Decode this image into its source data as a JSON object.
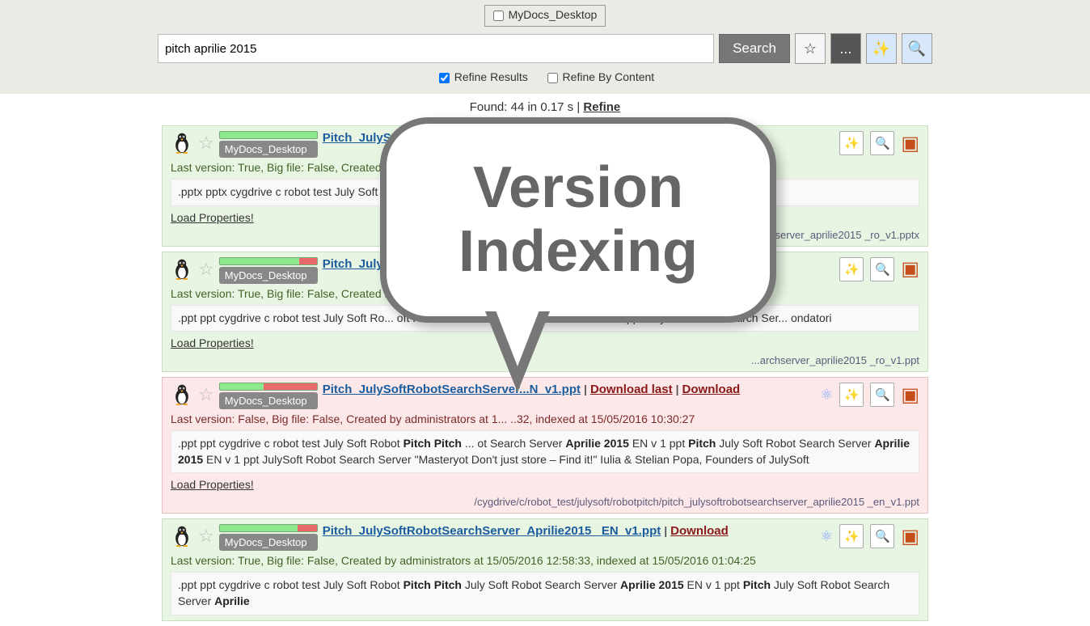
{
  "scope": {
    "label": "MyDocs_Desktop",
    "checked": false
  },
  "search": {
    "query": "pitch aprilie 2015",
    "buttonLabel": "Search",
    "starTitle": "Favorite",
    "moreLabel": "...",
    "wandTitle": "Wizard",
    "previewTitle": "Preview"
  },
  "refine": {
    "refineResults": {
      "label": "Refine Results",
      "checked": true
    },
    "refineByContent": {
      "label": "Refine By Content",
      "checked": false
    }
  },
  "foundBar": {
    "prefix": "Found: ",
    "count": "44",
    "timePrefix": " in ",
    "time": "0.17 s",
    "sep": "  |  ",
    "refineLink": "Refine"
  },
  "callout": {
    "line1": "Version",
    "line2": "Indexing"
  },
  "results": [
    {
      "tone": "green",
      "redPct": 0,
      "badge": "MyDocs_Desktop",
      "title": "Pitch_JulySoft",
      "titleTail": "",
      "downloads": [],
      "meta": "Last version: True, Big file: False, Created by ",
      "snippet": ".pptx pptx cygdrive c robot test July Soft R... y Soft Robot Search Server <b>Aprilie 2015</b> RO v 1 pptx",
      "loadProps": "Load Properties!",
      "path": "...chserver_aprilie2015 _ro_v1.pptx",
      "icons": {
        "ppt": true,
        "wand": true,
        "preview": true,
        "graph": false
      }
    },
    {
      "tone": "green",
      "redPct": 18,
      "badge": "MyDocs_Desktop",
      "title": "Pitch_July",
      "titleTail": "",
      "downloads": [],
      "meta": "Last version: True, Big file: False, Created by ",
      "snippet": ".ppt ppt cygdrive c robot test July Soft Ro... oft Robot Search Server <b>Aprilie 2015</b> RO v 1 ppt JulySoft Robot Search Ser... ondatori",
      "loadProps": "Load Properties!",
      "path": "...archserver_aprilie2015 _ro_v1.ppt",
      "icons": {
        "ppt": true,
        "wand": true,
        "preview": true,
        "graph": false
      }
    },
    {
      "tone": "pink",
      "redPct": 55,
      "badge": "MyDocs_Desktop",
      "title": "Pitch_JulySoftRobotSearchServer",
      "titleTail": "...N_v1.ppt",
      "downloads": [
        "Download last",
        "Download"
      ],
      "meta": "Last version: False, Big file: False, Created by administrators at 1... ..32, indexed at 15/05/2016 10:30:27",
      "snippet": ".ppt ppt cygdrive c robot test July Soft Robot <b>Pitch Pitch</b> ... ot Search Server <b>Aprilie 2015</b> EN v 1 ppt <b>Pitch</b> July Soft Robot Search Server <b>Aprilie 2015</b> EN v 1 ppt JulySoft Robot Search Server \"Masteryot     Don't just store – Find it!\" Iulia & Stelian Popa, Founders of JulySoft",
      "loadProps": "Load Properties!",
      "path": "/cygdrive/c/robot_test/julysoft/robotpitch/pitch_julysoftrobotsearchserver_aprilie2015 _en_v1.ppt",
      "icons": {
        "ppt": true,
        "wand": true,
        "preview": true,
        "graph": true
      }
    },
    {
      "tone": "green",
      "redPct": 20,
      "badge": "MyDocs_Desktop",
      "title": "Pitch_JulySoftRobotSearchServer_Aprilie2015 _EN_v1.ppt",
      "titleTail": "",
      "downloads": [
        "Download"
      ],
      "meta": "Last version: True, Big file: False, Created by administrators at 15/05/2016 12:58:33, indexed at 15/05/2016 01:04:25",
      "snippet": ".ppt ppt cygdrive c robot test July Soft Robot <b>Pitch Pitch</b> July Soft Robot Search Server <b>Aprilie 2015</b> EN v 1 ppt <b>Pitch</b> July Soft Robot Search Server <b>Aprilie</b>",
      "loadProps": "",
      "path": "",
      "icons": {
        "ppt": true,
        "wand": true,
        "preview": true,
        "graph": true
      }
    }
  ]
}
